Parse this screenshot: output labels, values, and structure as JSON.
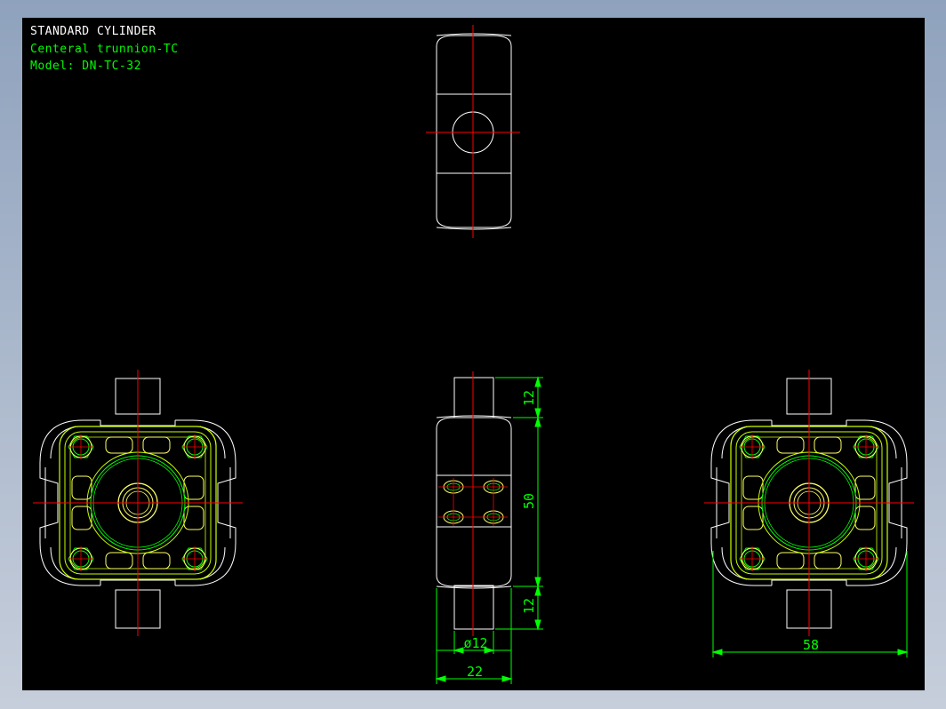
{
  "title_block": {
    "line1": "STANDARD CYLINDER",
    "line2": "Centeral trunnion-TC",
    "line3": "Model: DN-TC-32"
  },
  "dimensions": {
    "upper_pin_length": "12",
    "body_length": "50",
    "lower_pin_length": "12",
    "pin_diameter": "ø12",
    "trunnion_width": "22",
    "flange_width": "58"
  },
  "colors": {
    "background": "#000000",
    "outline": "#ffffff",
    "centerline": "#ff0000",
    "dimension": "#00ff00",
    "detail": "#ffff00",
    "title_text": "#ffffff",
    "info_text": "#00ff00"
  }
}
